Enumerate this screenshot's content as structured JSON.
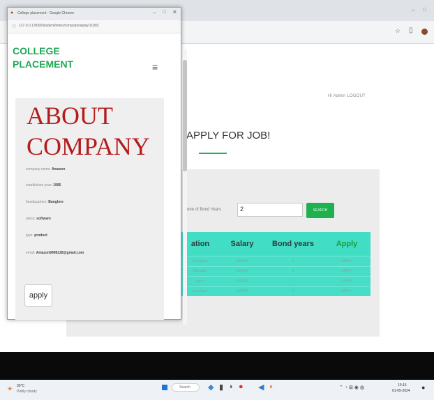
{
  "popup": {
    "window_title": "College placement - Google Chrome",
    "url": "127.0.0.1:8000/student/index/company/apply/11903",
    "brand_line1": "COLLEGE",
    "brand_line2": "PLACEMENT",
    "about_line1": "ABOUT",
    "about_line2": "COMPANY",
    "fields": [
      {
        "label": "company name:",
        "value": "Amazon"
      },
      {
        "label": "established year:",
        "value": "1995"
      },
      {
        "label": "headquarters:",
        "value": "Banglore"
      },
      {
        "label": "about:",
        "value": "software"
      },
      {
        "label": "type:",
        "value": "product"
      },
      {
        "label": "email:",
        "value": "Amazon9998128@gmail.com"
      }
    ],
    "apply_label": "apply"
  },
  "page": {
    "welcome": "Hi Admin LOGOUT",
    "title": "APPLY FOR JOB!",
    "search_label": "Name of Bond Years",
    "search_value": "2",
    "search_button": "SEARCH",
    "table": {
      "headers": [
        "ation",
        "Salary",
        "Bond years",
        "Apply"
      ],
      "rows": [
        [
          "developer",
          "400000",
          "2",
          "APPLY"
        ],
        [
          "Manager",
          "450000",
          "2",
          "APPLY"
        ],
        [
          "tester",
          "300000",
          "2",
          "APPLY"
        ],
        [
          "developer",
          "350000",
          "2",
          "APPLY"
        ]
      ]
    }
  },
  "taskbar": {
    "weather": "30°C",
    "weather_desc": "Partly cloudy",
    "search": "Search",
    "clock_time": "10:15",
    "clock_date": "01-05-2024"
  },
  "colors": {
    "accent_green": "#21b356",
    "table_teal": "#42ddc5",
    "about_red": "#b31c1c"
  }
}
